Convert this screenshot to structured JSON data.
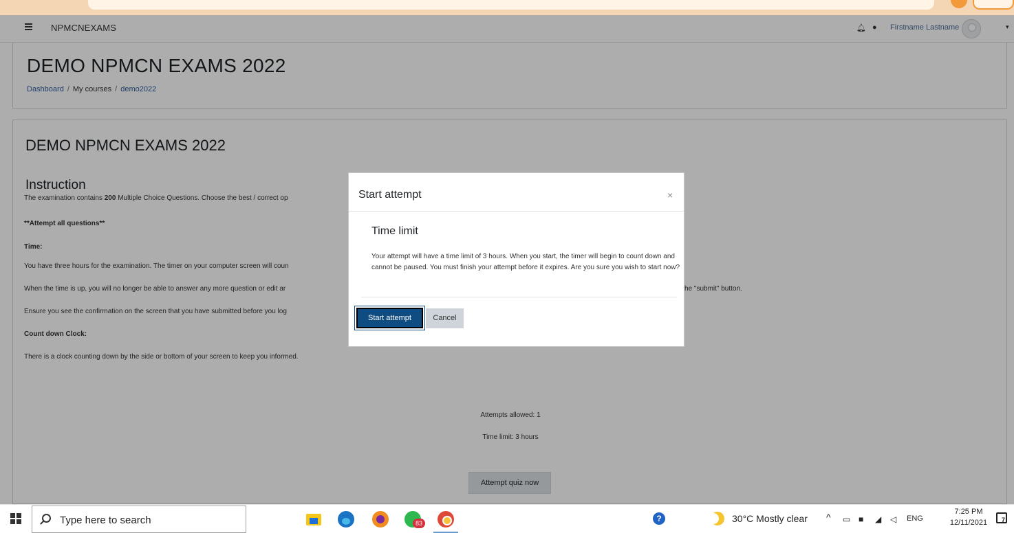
{
  "navbar": {
    "site_name": "NPMCNEXAMS",
    "user_name": "Firstname Lastname"
  },
  "header": {
    "title": "DEMO NPMCN EXAMS 2022",
    "breadcrumb": [
      "Dashboard",
      "My courses",
      "demo2022"
    ],
    "separator": "/"
  },
  "main": {
    "course_title": "DEMO NPMCN EXAMS 2022",
    "instruction_heading": "Instruction",
    "line1_pre": "The examination contains ",
    "line1_bold": "200",
    "line1_post": " Multiple Choice Questions. Choose the best / correct op",
    "attempt_all": "**Attempt all questions**",
    "time_heading": "Time:",
    "time_line1": "You have three hours for the examination. The timer on your computer screen will coun",
    "time_line2": "When the time is up, you will no longer be able to answer any more question or edit ar",
    "time_line2_end": "he \"submit\" button.",
    "time_line3": "Ensure you see the confirmation on the screen that you have submitted before you log",
    "countdown_heading": "Count down Clock:",
    "countdown_text": "There is a clock counting down by the side or bottom of your screen to keep you informed.",
    "attempts_allowed": "Attempts allowed: 1",
    "time_limit": "Time limit: 3 hours",
    "attempt_button": "Attempt quiz now"
  },
  "modal": {
    "title": "Start attempt",
    "close": "×",
    "section_heading": "Time limit",
    "body": "Your attempt will have a time limit of 3 hours. When you start, the timer will begin to count down and cannot be paused. You must finish your attempt before it expires. Are you sure you wish to start now?",
    "primary_button": "Start attempt",
    "secondary_button": "Cancel"
  },
  "taskbar": {
    "search_placeholder": "Type here to search",
    "whatsapp_badge": "83",
    "help": "?",
    "weather": "30°C  Mostly clear",
    "tray_caret": "^",
    "language": "ENG",
    "time": "7:25 PM",
    "date": "12/11/2021",
    "notification_count": "7"
  },
  "colors": {
    "primary": "#0f4c81",
    "link": "#2e5b9a",
    "backdrop": "rgba(0,0,0,0.32)"
  }
}
